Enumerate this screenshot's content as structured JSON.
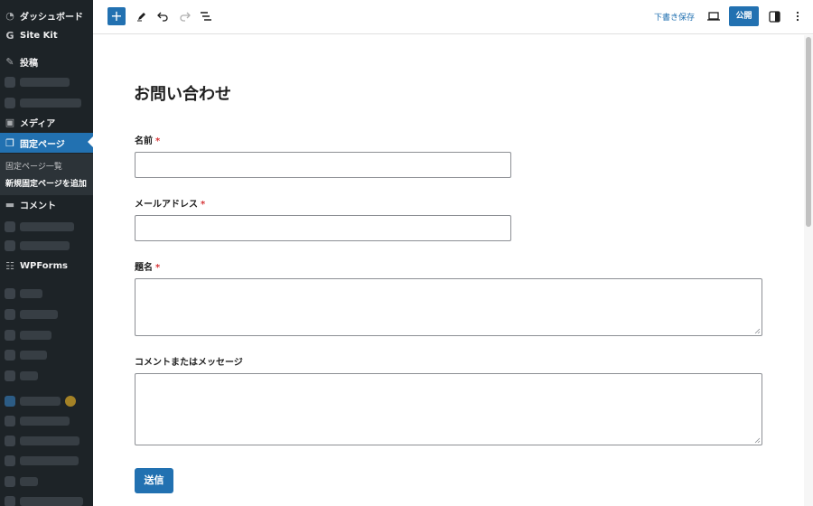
{
  "sidebar": {
    "items": [
      {
        "icon": "dashboard-icon",
        "label": "ダッシュボード"
      },
      {
        "icon": "google-g-icon",
        "label": "Site Kit"
      },
      {
        "icon": "pin-icon",
        "label": "投稿"
      },
      {
        "icon": "media-icon",
        "label": "メディア"
      },
      {
        "icon": "pages-icon",
        "label": "固定ページ"
      },
      {
        "icon": "comment-icon",
        "label": "コメント"
      },
      {
        "icon": "wpforms-icon",
        "label": "WPForms"
      }
    ],
    "submenu": [
      "固定ページ一覧",
      "新規固定ページを追加"
    ]
  },
  "toolbar": {
    "add_label": "+",
    "draft_label": "下書き保存",
    "publish_label": "公開",
    "icons": [
      "add-block-icon",
      "pencil-icon",
      "undo-icon",
      "redo-icon",
      "list-view-icon",
      "preview-icon",
      "settings-panel-icon",
      "more-options-icon"
    ]
  },
  "page": {
    "title": "お問い合わせ",
    "fields": [
      {
        "label": "名前",
        "required": "*",
        "type": "input"
      },
      {
        "label": "メールアドレス",
        "required": "*",
        "type": "input"
      },
      {
        "label": "題名",
        "required": "*",
        "type": "textarea"
      },
      {
        "label": "コメントまたはメッセージ",
        "required": "",
        "type": "textarea"
      }
    ],
    "submit_label": "送信"
  },
  "colors": {
    "sidebar_bg": "#1d2327",
    "accent": "#2271b1",
    "required": "#d63638"
  }
}
